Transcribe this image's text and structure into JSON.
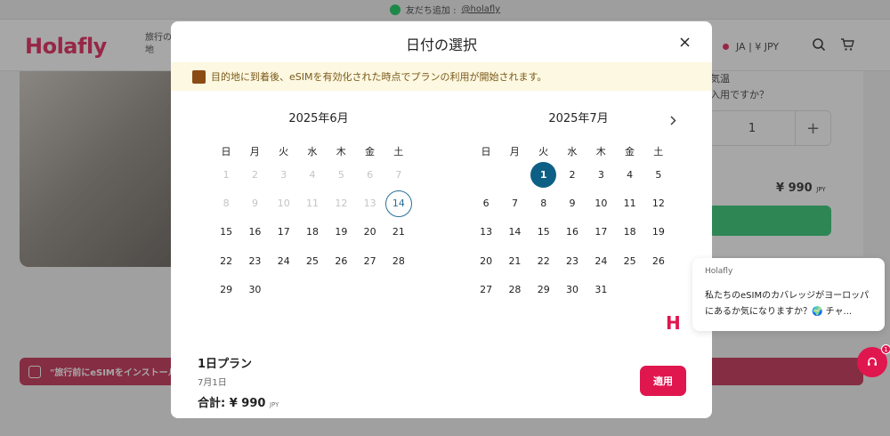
{
  "topbar": {
    "text": "友だち追加 :",
    "handle": "@holafly"
  },
  "header": {
    "logo": "Holafly",
    "nav_fragment": "旅行の 地",
    "language": "JA | ¥ JPY"
  },
  "product": {
    "line1": "気温",
    "line2": "入用ですか？",
    "quantity": "1",
    "plus": "+",
    "price": "¥ 990",
    "currency": "JPY"
  },
  "banner": {
    "text": "\"旅行前にeSIMをインストール"
  },
  "modal": {
    "title": "日付の選択",
    "notice": "目的地に到着後、eSIMを有効化された時点でプランの利用が開始されます。",
    "weekdays": [
      "日",
      "月",
      "火",
      "水",
      "木",
      "金",
      "土"
    ],
    "months": [
      {
        "title": "2025年6月",
        "weeks": [
          [
            "1",
            "2",
            "3",
            "4",
            "5",
            "6",
            "7"
          ],
          [
            "8",
            "9",
            "10",
            "11",
            "12",
            "13",
            "14"
          ],
          [
            "15",
            "16",
            "17",
            "18",
            "19",
            "20",
            "21"
          ],
          [
            "22",
            "23",
            "24",
            "25",
            "26",
            "27",
            "28"
          ],
          [
            "29",
            "30",
            "",
            "",
            "",
            "",
            ""
          ]
        ],
        "disabled_through": 13,
        "today": "14"
      },
      {
        "title": "2025年7月",
        "weeks": [
          [
            "",
            "",
            "1",
            "2",
            "3",
            "4",
            "5"
          ],
          [
            "6",
            "7",
            "8",
            "9",
            "10",
            "11",
            "12"
          ],
          [
            "13",
            "14",
            "15",
            "16",
            "17",
            "18",
            "19"
          ],
          [
            "20",
            "21",
            "22",
            "23",
            "24",
            "25",
            "26"
          ],
          [
            "27",
            "28",
            "29",
            "30",
            "31",
            "",
            ""
          ]
        ],
        "selected": "1"
      }
    ],
    "summary": {
      "plan": "1日プラン",
      "date": "7月1日",
      "total_label": "合計:",
      "total_value": "¥ 990",
      "currency": "JPY"
    },
    "apply_label": "適用"
  },
  "chat": {
    "sender": "Holafly",
    "message": "私たちのeSIMのカバレッジがヨーロッパにあるか気になりますか？🌍 チャ...",
    "badge_count": "1"
  },
  "colors": {
    "brand": "#e0164f",
    "selected_day": "#0e5f86",
    "notice_bg": "#fdf8e1"
  }
}
